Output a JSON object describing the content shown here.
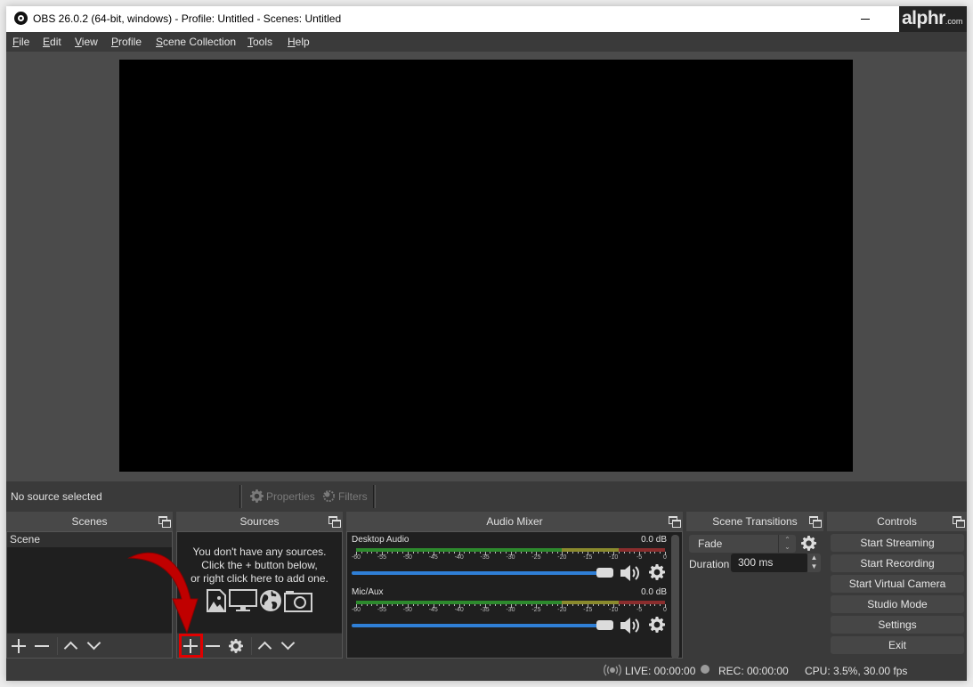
{
  "window": {
    "title": "OBS 26.0.2 (64-bit, windows) - Profile: Untitled - Scenes: Untitled",
    "watermark": {
      "brand": "alphr",
      "suffix": ".com"
    }
  },
  "menu": [
    {
      "label": "File",
      "accel": "F"
    },
    {
      "label": "Edit",
      "accel": "E"
    },
    {
      "label": "View",
      "accel": "V"
    },
    {
      "label": "Profile",
      "accel": "P"
    },
    {
      "label": "Scene Collection",
      "accel": "S"
    },
    {
      "label": "Tools",
      "accel": "T"
    },
    {
      "label": "Help",
      "accel": "H"
    }
  ],
  "context_bar": {
    "status": "No source selected",
    "properties_label": "Properties",
    "filters_label": "Filters"
  },
  "docks": {
    "scenes": {
      "title": "Scenes",
      "items": [
        "Scene"
      ]
    },
    "sources": {
      "title": "Sources",
      "empty_lines": [
        "You don't have any sources.",
        "Click the + button below,",
        "or right click here to add one."
      ],
      "empty_icons": [
        "image-icon",
        "monitor-icon",
        "globe-icon",
        "camera-icon"
      ]
    },
    "audio_mixer": {
      "title": "Audio Mixer",
      "scale_labels": [
        "-60",
        "-55",
        "-50",
        "-45",
        "-40",
        "-35",
        "-30",
        "-25",
        "-20",
        "-15",
        "-10",
        "-5",
        "0"
      ],
      "channels": [
        {
          "name": "Desktop Audio",
          "level": "0.0 dB",
          "volume_fraction": 1.0
        },
        {
          "name": "Mic/Aux",
          "level": "0.0 dB",
          "volume_fraction": 1.0
        }
      ],
      "meter_colors": {
        "green": "#2d8a2d",
        "yellow": "#8a8a2d",
        "red": "#8a2d2d"
      }
    },
    "scene_transitions": {
      "title": "Scene Transitions",
      "transition": "Fade",
      "duration_label": "Duration",
      "duration_value": "300 ms"
    },
    "controls": {
      "title": "Controls",
      "buttons": [
        "Start Streaming",
        "Start Recording",
        "Start Virtual Camera",
        "Studio Mode",
        "Settings",
        "Exit"
      ]
    }
  },
  "status": {
    "live": "LIVE: 00:00:00",
    "rec": "REC: 00:00:00",
    "cpu": "CPU: 3.5%, 30.00 fps"
  },
  "annotation": {
    "highlight_color": "#e00000",
    "target": "add-source-button"
  }
}
